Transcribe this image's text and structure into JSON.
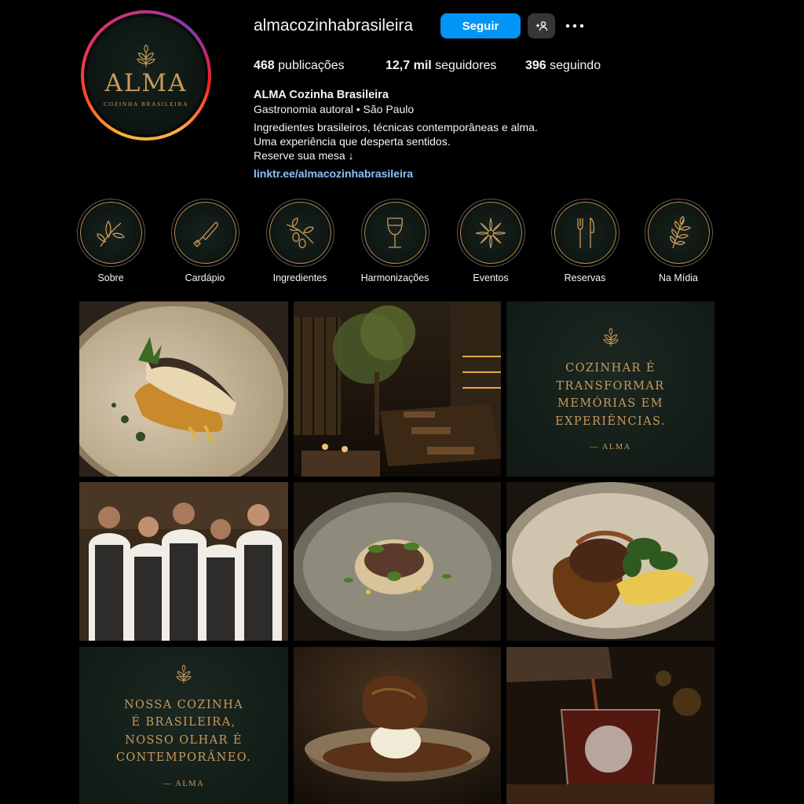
{
  "profile": {
    "username": "almacozinhabrasileira",
    "follow_label": "Seguir",
    "suggest_icon": "add-person-icon",
    "more_icon": "more-horizontal-icon",
    "avatar": {
      "word": "ALMA",
      "sub": "COZINHA BRASILEIRA"
    },
    "stats": {
      "posts_value": "468",
      "posts_label": " publicações",
      "followers_value": "12,7 mil",
      "followers_label": " seguidores",
      "following_value": "396",
      "following_label": " seguindo"
    },
    "bio": {
      "name": "ALMA Cozinha Brasileira",
      "category": "Gastronomia autoral • São Paulo",
      "line1": "Ingredientes brasileiros, técnicas contemporâneas e alma.",
      "line2": "Uma experiência que desperta sentidos.",
      "line3": "Reserve sua mesa ↓",
      "link": "linktr.ee/almacozinhabrasileira"
    }
  },
  "highlights": [
    {
      "label": "Sobre",
      "icon": "leaf-icon"
    },
    {
      "label": "Cardápio",
      "icon": "knife-icon"
    },
    {
      "label": "Ingredientes",
      "icon": "olive-branch-icon"
    },
    {
      "label": "Harmonizações",
      "icon": "wine-glass-icon"
    },
    {
      "label": "Eventos",
      "icon": "flower-icon"
    },
    {
      "label": "Reservas",
      "icon": "cutlery-icon"
    },
    {
      "label": "Na Mídia",
      "icon": "branch-icon"
    }
  ],
  "posts": {
    "quote1": {
      "lines": [
        "COZINHAR É",
        "TRANSFORMAR",
        "MEMÓRIAS EM",
        "EXPERIÊNCIAS."
      ],
      "sign": "— ALMA"
    },
    "quote2": {
      "lines": [
        "NOSSA COZINHA",
        "É BRASILEIRA,",
        "NOSSO OLHAR É",
        "CONTEMPORÂNEO."
      ],
      "sign": "— ALMA"
    }
  },
  "colors": {
    "accent_gold": "#c99a5b",
    "follow_blue": "#0095f6",
    "link_blue": "#8ac2ff",
    "bg": "#000000"
  }
}
